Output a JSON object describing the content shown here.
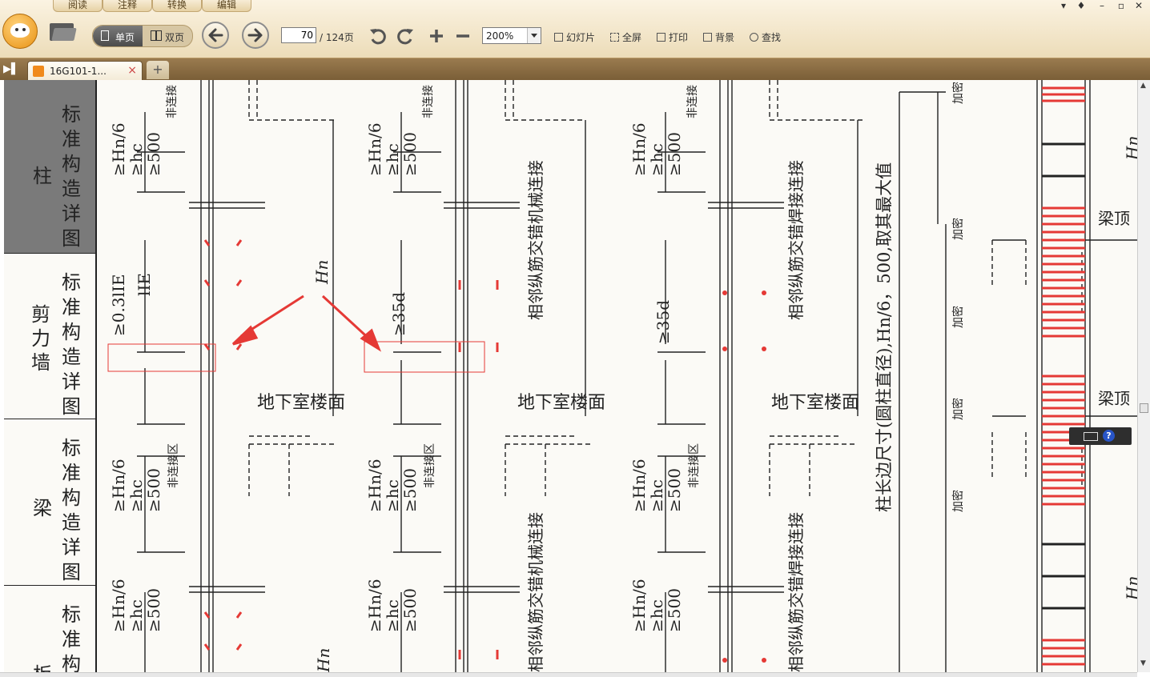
{
  "menu": {
    "tabs": [
      {
        "label": "阅读"
      },
      {
        "label": "注释"
      },
      {
        "label": "转换"
      },
      {
        "label": "编辑"
      }
    ]
  },
  "toolbar": {
    "view_single": "单页",
    "view_double": "双页",
    "page_current": "70",
    "page_total": "/ 124页",
    "zoom": "200%",
    "slideshow": "幻灯片",
    "fullscreen": "全屏",
    "print": "打印",
    "background": "背景",
    "find": "查找"
  },
  "tabbar": {
    "doc_tab_title": "16G101-1...",
    "close_glyph": "×",
    "new_tab_glyph": "+"
  },
  "document": {
    "side_index": [
      {
        "major": "柱",
        "minor": "标准构造详图",
        "active": true
      },
      {
        "major": "剪力墙",
        "minor": "标准构造详图",
        "active": false
      },
      {
        "major": "梁",
        "minor": "标准构造详图",
        "active": false
      },
      {
        "major": "板",
        "minor": "标准构",
        "active": false
      }
    ],
    "labels": {
      "non_joint": "非连接",
      "non_joint_zone": "非连接区",
      "hn6": "≥Hn/6",
      "hc": "≥hc",
      "g500": "≥500",
      "hn": "Hn",
      "l03le": "≥0.3lIE",
      "lle": "lIE",
      "g35d": "≥35d",
      "basement_floor": "地下室楼面",
      "mech_joint": "相邻纵筋交错机械连接",
      "weld_joint": "相邻纵筋交错焊接连接",
      "note": "柱长边尺寸(圆柱直径),Hn/6，500,取其最大值",
      "dense": "加密",
      "beam_top": "梁顶"
    }
  },
  "colors": {
    "accent_red": "#e53935",
    "toolbar_bg": "#f3e7cb",
    "tabbar_bg": "#8a6c42"
  },
  "icons": [
    "app-logo-icon",
    "folder-open-icon",
    "single-page-icon",
    "double-page-icon",
    "arrow-left-icon",
    "arrow-right-icon",
    "rotate-left-icon",
    "rotate-right-icon",
    "zoom-in-icon",
    "zoom-out-icon",
    "slideshow-icon",
    "fullscreen-icon",
    "print-icon",
    "background-icon",
    "search-icon",
    "keyboard-icon",
    "help-icon"
  ]
}
